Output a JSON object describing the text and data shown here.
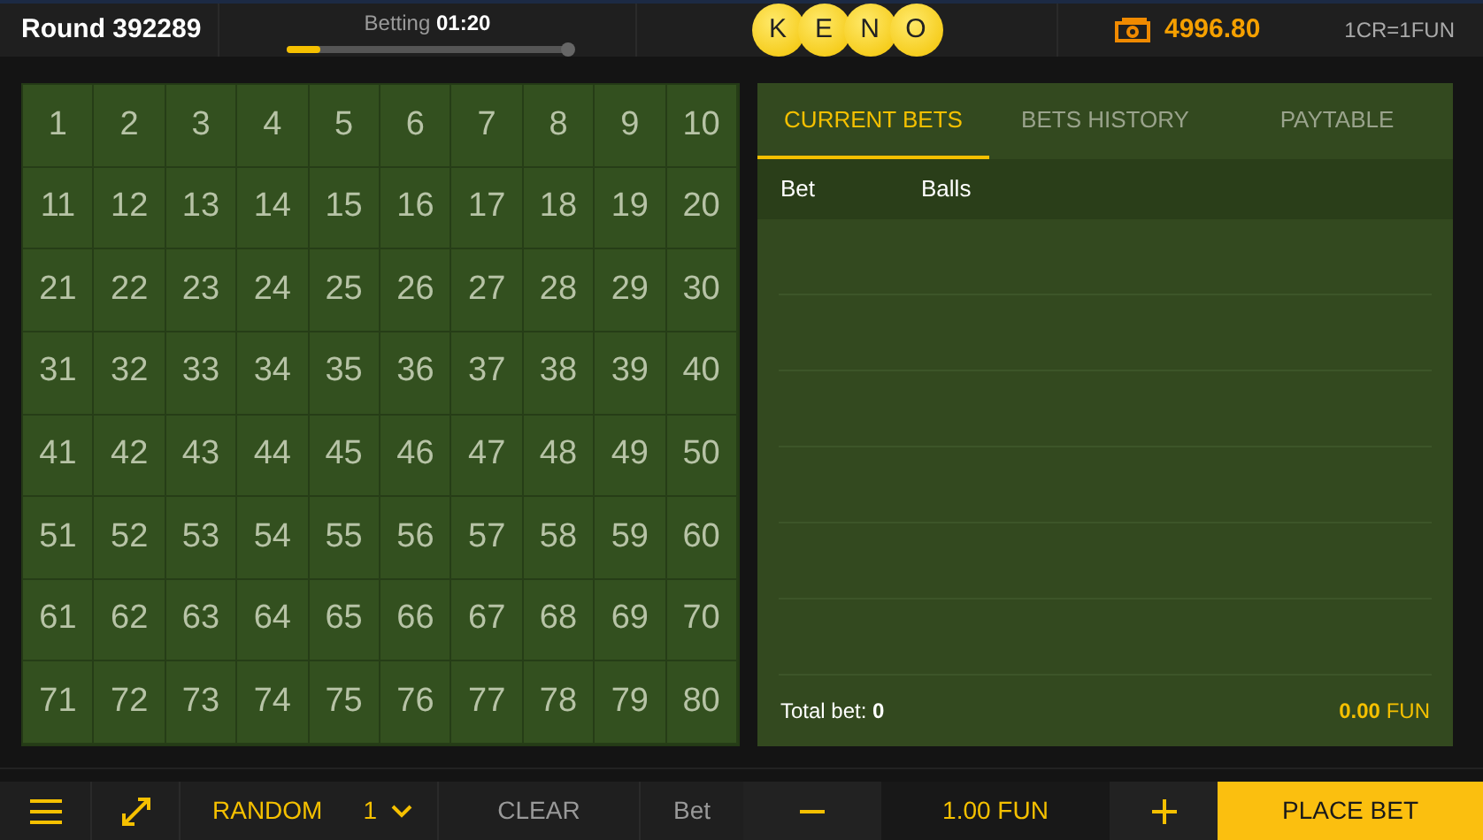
{
  "header": {
    "round_label": "Round",
    "round_number": "392289",
    "status_label": "Betting",
    "timer": "01:20",
    "progress": {
      "level": 0.12
    },
    "logo_letters": [
      "K",
      "E",
      "N",
      "O"
    ],
    "balance": "4996.80",
    "rate": "1CR=1FUN"
  },
  "numbers": [
    "1",
    "2",
    "3",
    "4",
    "5",
    "6",
    "7",
    "8",
    "9",
    "10",
    "11",
    "12",
    "13",
    "14",
    "15",
    "16",
    "17",
    "18",
    "19",
    "20",
    "21",
    "22",
    "23",
    "24",
    "25",
    "26",
    "27",
    "28",
    "29",
    "30",
    "31",
    "32",
    "33",
    "34",
    "35",
    "36",
    "37",
    "38",
    "39",
    "40",
    "41",
    "42",
    "43",
    "44",
    "45",
    "46",
    "47",
    "48",
    "49",
    "50",
    "51",
    "52",
    "53",
    "54",
    "55",
    "56",
    "57",
    "58",
    "59",
    "60",
    "61",
    "62",
    "63",
    "64",
    "65",
    "66",
    "67",
    "68",
    "69",
    "70",
    "71",
    "72",
    "73",
    "74",
    "75",
    "76",
    "77",
    "78",
    "79",
    "80"
  ],
  "panel": {
    "tabs": [
      {
        "label": "CURRENT BETS",
        "selected": true
      },
      {
        "label": "BETS HISTORY",
        "selected": false
      },
      {
        "label": "PAYTABLE",
        "selected": false
      }
    ],
    "columns": [
      "Bet",
      "Balls"
    ],
    "total_label": "Total bet:",
    "total_value": "0",
    "total_amount": "0.00",
    "currency": "FUN"
  },
  "toolbar": {
    "random_label": "RANDOM",
    "random_count": "1",
    "clear_label": "CLEAR",
    "bet_label": "Bet",
    "bet_value": "1.00 FUN",
    "place_bet_label": "PLACE BET"
  }
}
